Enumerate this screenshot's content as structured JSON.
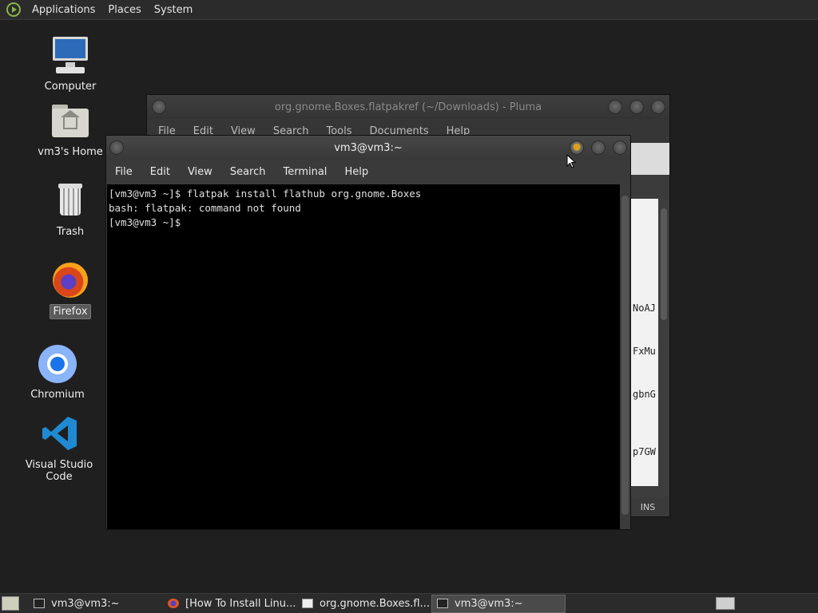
{
  "top_panel": {
    "menus": [
      "Applications",
      "Places",
      "System"
    ]
  },
  "desktop": {
    "icons": [
      {
        "label": "Computer",
        "icon": "computer-icon"
      },
      {
        "label": "vm3's Home",
        "icon": "home-folder-icon"
      },
      {
        "label": "Trash",
        "icon": "trash-icon"
      },
      {
        "label": "Firefox",
        "icon": "firefox-icon",
        "selected": true
      },
      {
        "label": "Chromium",
        "icon": "chromium-icon"
      },
      {
        "label": "Visual Studio Code",
        "icon": "vscode-icon"
      }
    ]
  },
  "pluma": {
    "title": "org.gnome.Boxes.flatpakref (~/Downloads) - Pluma",
    "menus": [
      "File",
      "Edit",
      "View",
      "Search",
      "Tools",
      "Documents",
      "Help"
    ],
    "visible_text_fragments": [
      "NoAJ",
      "FxMu",
      "gbnG",
      "p7GW"
    ],
    "status_mode": "INS"
  },
  "terminal": {
    "title": "vm3@vm3:~",
    "menus": [
      "File",
      "Edit",
      "View",
      "Search",
      "Terminal",
      "Help"
    ],
    "lines": [
      "[vm3@vm3 ~]$ flatpak install flathub org.gnome.Boxes",
      "bash: flatpak: command not found",
      "[vm3@vm3 ~]$ "
    ]
  },
  "taskbar": {
    "items": [
      {
        "label": "vm3@vm3:~",
        "icon": "terminal-icon",
        "active": false
      },
      {
        "label": "[How To Install Linu...",
        "icon": "firefox-icon",
        "active": false
      },
      {
        "label": "org.gnome.Boxes.fl...",
        "icon": "text-editor-icon",
        "active": false
      },
      {
        "label": "vm3@vm3:~",
        "icon": "terminal-icon",
        "active": true
      }
    ]
  }
}
